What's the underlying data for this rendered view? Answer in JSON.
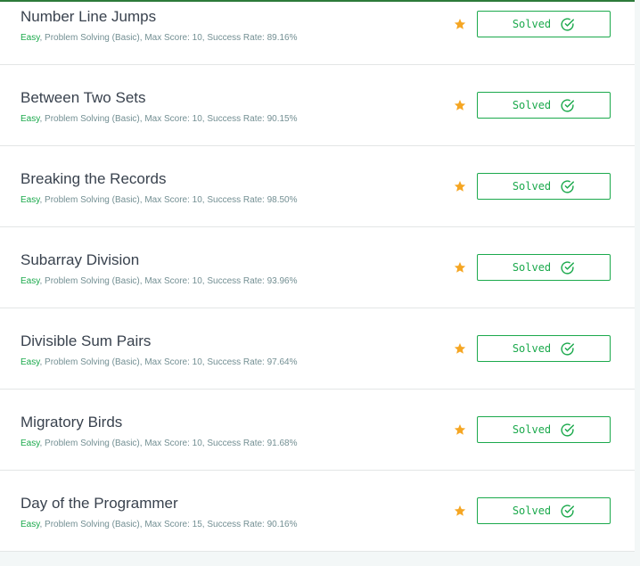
{
  "colors": {
    "accent": "#1ba94c",
    "star": "#f5a623",
    "title": "#39424e",
    "meta": "#738f93"
  },
  "challenges": [
    {
      "title": "Number Line Jumps",
      "difficulty": "Easy",
      "details": ", Problem Solving (Basic), Max Score: 10, Success Rate: 89.16%",
      "status_label": "Solved"
    },
    {
      "title": "Between Two Sets",
      "difficulty": "Easy",
      "details": ", Problem Solving (Basic), Max Score: 10, Success Rate: 90.15%",
      "status_label": "Solved"
    },
    {
      "title": "Breaking the Records",
      "difficulty": "Easy",
      "details": ", Problem Solving (Basic), Max Score: 10, Success Rate: 98.50%",
      "status_label": "Solved"
    },
    {
      "title": "Subarray Division",
      "difficulty": "Easy",
      "details": ", Problem Solving (Basic), Max Score: 10, Success Rate: 93.96%",
      "status_label": "Solved"
    },
    {
      "title": "Divisible Sum Pairs",
      "difficulty": "Easy",
      "details": ", Problem Solving (Basic), Max Score: 10, Success Rate: 97.64%",
      "status_label": "Solved"
    },
    {
      "title": "Migratory Birds",
      "difficulty": "Easy",
      "details": ", Problem Solving (Basic), Max Score: 10, Success Rate: 91.68%",
      "status_label": "Solved"
    },
    {
      "title": "Day of the Programmer",
      "difficulty": "Easy",
      "details": ", Problem Solving (Basic), Max Score: 15, Success Rate: 90.16%",
      "status_label": "Solved"
    }
  ]
}
